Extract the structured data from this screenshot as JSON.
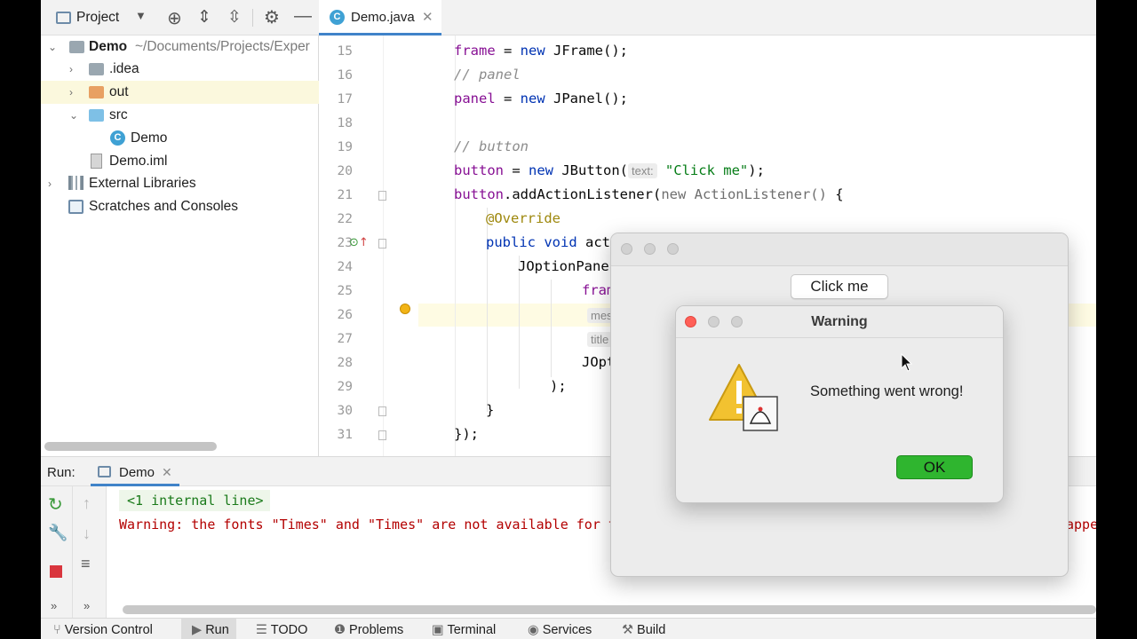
{
  "project_panel": {
    "title": "Project",
    "tree": [
      {
        "label": "Demo",
        "suffix": "~/Documents/Projects/Exper"
      },
      {
        "label": ".idea"
      },
      {
        "label": "out"
      },
      {
        "label": "src"
      },
      {
        "label": "Demo"
      },
      {
        "label": "Demo.iml"
      },
      {
        "label": "External Libraries"
      },
      {
        "label": "Scratches and Consoles"
      }
    ]
  },
  "editor": {
    "tab": "Demo.java",
    "line_numbers": [
      "15",
      "16",
      "17",
      "18",
      "19",
      "20",
      "21",
      "22",
      "23",
      "24",
      "25",
      "26",
      "27",
      "28",
      "29",
      "30",
      "31"
    ],
    "code": {
      "l15_a": "frame",
      "l15_b": " = ",
      "l15_c": "new",
      "l15_d": " JFrame();",
      "l16": "// panel",
      "l17_a": "panel",
      "l17_b": " = ",
      "l17_c": "new",
      "l17_d": " JPanel();",
      "l19": "// button",
      "l20_a": "button",
      "l20_b": " = ",
      "l20_c": "new",
      "l20_d": " JButton(",
      "l20_hint": "text:",
      "l20_e": "\"Click me\"",
      "l20_f": ");",
      "l21_a": "button",
      "l21_b": ".addActionListener(",
      "l21_c": "new ActionListener()",
      "l21_d": " {",
      "l22": "@Override",
      "l23_a": "public void",
      "l23_b": " acti",
      "l24": "JOptionPane.",
      "l25": "fram",
      "l26": "mes",
      "l27": "title",
      "l28": "JOpt",
      "l29": ");",
      "l30": "}",
      "l31": "});"
    }
  },
  "run_panel": {
    "label": "Run:",
    "tab": "Demo",
    "console": {
      "line1": "<1 internal line>",
      "line2": "Warning: the fonts \"Times\" and \"Times\" are not available for t",
      "line2_tail": "appe"
    }
  },
  "statusbar": {
    "items": [
      "Version Control",
      "Run",
      "TODO",
      "Problems",
      "Terminal",
      "Services",
      "Build"
    ]
  },
  "frame_window": {
    "button": "Click me"
  },
  "dialog": {
    "title": "Warning",
    "message": "Something went wrong!",
    "ok": "OK"
  },
  "colors": {
    "ok_button": "#2fb52f",
    "console_warning": "#b30000",
    "console_info": "#1a7a1a",
    "stop_button": "#d9363e"
  }
}
